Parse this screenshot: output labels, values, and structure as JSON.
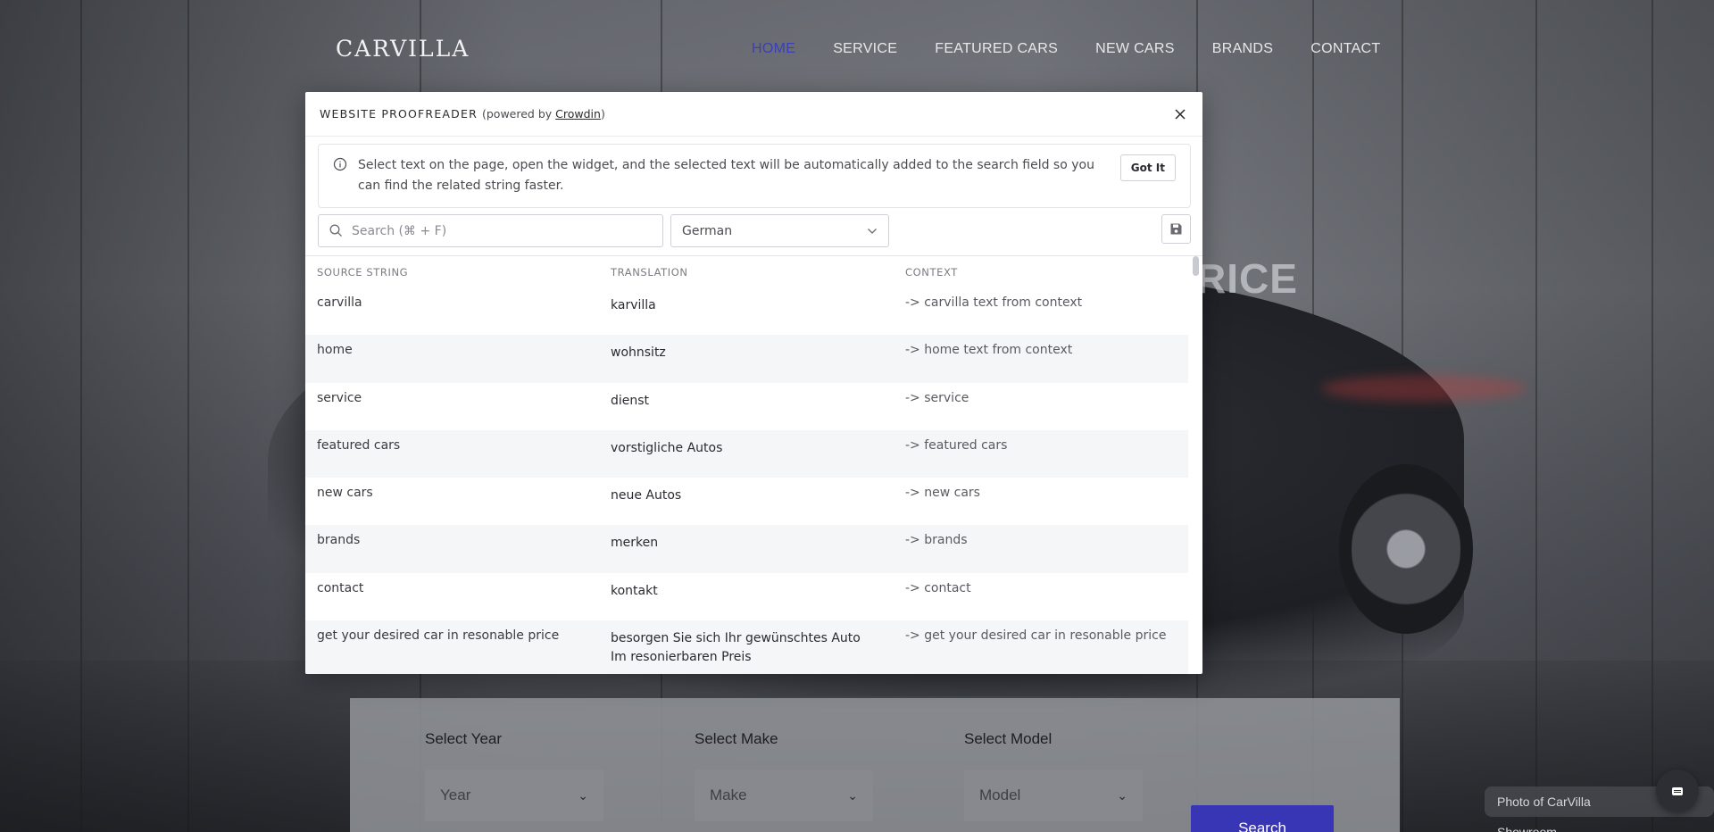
{
  "site": {
    "logo": "CARVILLA",
    "nav": [
      "HOME",
      "SERVICE",
      "FEATURED CARS",
      "NEW CARS",
      "BRANDS",
      "CONTACT"
    ],
    "hero_fragment": "RICE",
    "search_panel": {
      "year_label": "Select Year",
      "year_value": "Year",
      "make_label": "Select Make",
      "make_value": "Make",
      "model_label": "Select Model",
      "model_value": "Model",
      "search_button": "Search"
    },
    "caption": "Photo of CarVilla Showroom"
  },
  "proofreader": {
    "title": "WEBSITE PROOFREADER",
    "powered_prefix": "(powered by ",
    "powered_link": "Crowdin",
    "powered_suffix": ")",
    "info_text": "Select text on the page, open the widget, and the selected text will be automatically added to the search field so you can find the related string faster.",
    "got_it": "Got It",
    "search_placeholder": "Search (⌘ + F)",
    "language": "German",
    "columns": [
      "SOURCE STRING",
      "TRANSLATION",
      "CONTEXT"
    ],
    "rows": [
      {
        "source": "carvilla",
        "translation": "karvilla",
        "context": "-> carvilla text from context"
      },
      {
        "source": "home",
        "translation": "wohnsitz",
        "context": "-> home text from context"
      },
      {
        "source": "service",
        "translation": "dienst",
        "context": "-> service"
      },
      {
        "source": "featured cars",
        "translation": "vorstigliche Autos",
        "context": "-> featured cars"
      },
      {
        "source": "new cars",
        "translation": "neue Autos",
        "context": "-> new cars"
      },
      {
        "source": "brands",
        "translation": "merken",
        "context": "-> brands"
      },
      {
        "source": "contact",
        "translation": "kontakt",
        "context": "-> contact"
      },
      {
        "source": "get your desired car in resonable price",
        "translation": "besorgen Sie sich Ihr gewünschtes Auto Im resonierbaren Preis",
        "context": "-> get your desired car in resonable price"
      }
    ]
  }
}
